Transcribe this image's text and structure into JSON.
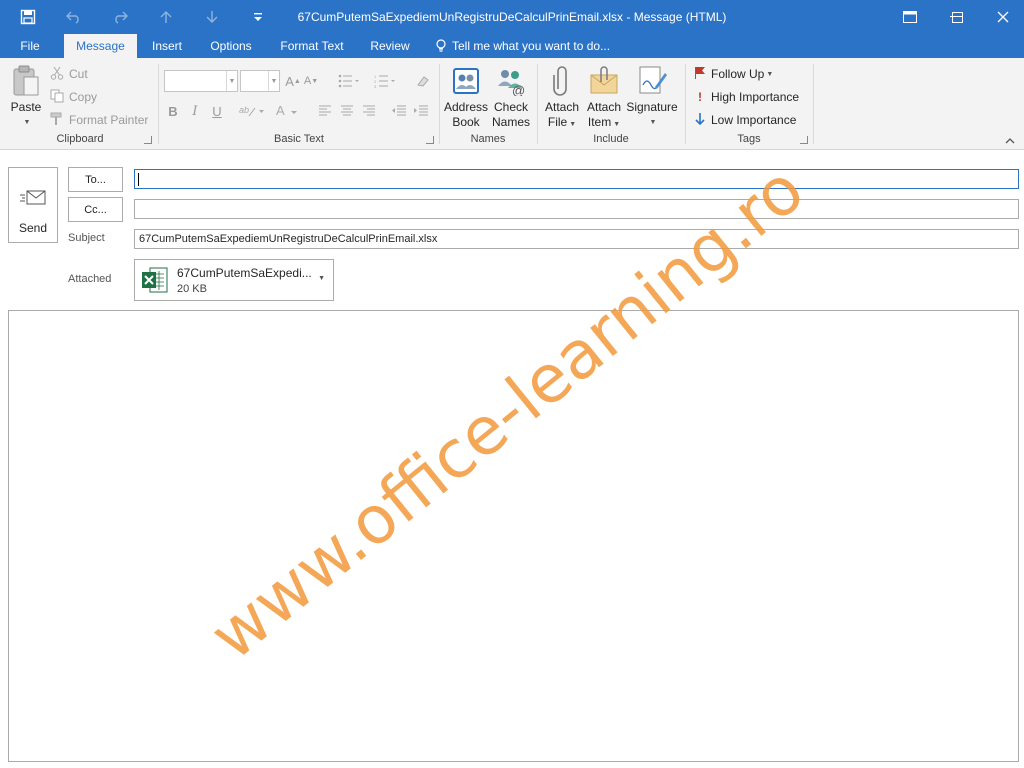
{
  "window": {
    "title": "67CumPutemSaExpediemUnRegistruDeCalculPrinEmail.xlsx - Message (HTML)",
    "colors": {
      "accent": "#2b73c6",
      "ribbon_bg": "#f3f3f3",
      "flag": "#c0392b",
      "watermark": "#f39a3a",
      "excel_green": "#1f7244"
    }
  },
  "quick_access": [
    "save-icon",
    "undo-icon",
    "redo-icon",
    "up-icon",
    "down-icon",
    "customize-icon"
  ],
  "tabs": [
    {
      "label": "File"
    },
    {
      "label": "Message",
      "active": true
    },
    {
      "label": "Insert"
    },
    {
      "label": "Options"
    },
    {
      "label": "Format Text"
    },
    {
      "label": "Review"
    }
  ],
  "tell_me": "Tell me what you want to do...",
  "ribbon": {
    "clipboard": {
      "paste": "Paste",
      "cut": "Cut",
      "copy": "Copy",
      "format_painter": "Format Painter",
      "label": "Clipboard"
    },
    "basic_text": {
      "label": "Basic Text"
    },
    "names": {
      "address_book_line1": "Address",
      "address_book_line2": "Book",
      "check_names_line1": "Check",
      "check_names_line2": "Names",
      "label": "Names"
    },
    "include": {
      "attach_file_line1": "Attach",
      "attach_file_line2": "File",
      "attach_item_line1": "Attach",
      "attach_item_line2": "Item",
      "signature": "Signature",
      "label": "Include"
    },
    "tags": {
      "follow_up": "Follow Up",
      "high_importance": "High Importance",
      "low_importance": "Low Importance",
      "label": "Tags"
    }
  },
  "compose": {
    "send": "Send",
    "to_button": "To...",
    "cc_button": "Cc...",
    "to_value": "",
    "cc_value": "",
    "subject_label": "Subject",
    "subject_value": "67CumPutemSaExpediemUnRegistruDeCalculPrinEmail.xlsx",
    "attached_label": "Attached",
    "attachment": {
      "name": "67CumPutemSaExpedi...",
      "size": "20 KB"
    },
    "body": ""
  },
  "watermark": "www.office-learning.ro"
}
